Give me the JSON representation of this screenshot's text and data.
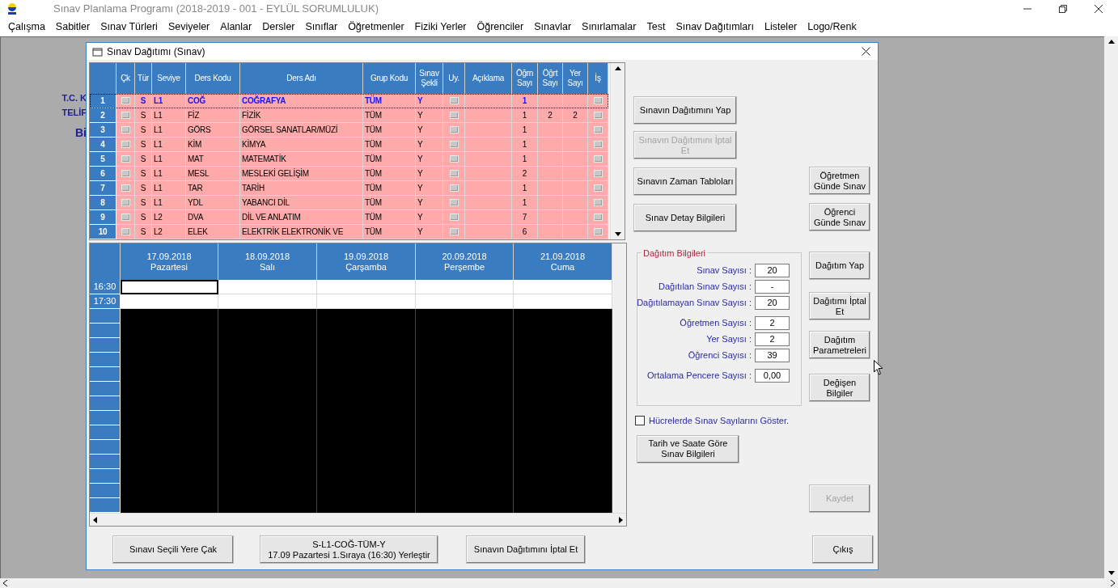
{
  "app": {
    "title": "Sınav Planlama Programı (2018-2019 - 001 - EYLÜL SORUMLULUK)",
    "menu": [
      "Çalışma",
      "Sabitler",
      "Sınav Türleri",
      "Seviyeler",
      "Alanlar",
      "Dersler",
      "Sınıflar",
      "Öğretmenler",
      "Fiziki Yerler",
      "Öğrenciler",
      "Sınavlar",
      "Sınırlamalar",
      "Test",
      "Sınav Dağıtımları",
      "Listeler",
      "Logo/Renk"
    ]
  },
  "background_texts": [
    "T.C. K",
    "TELİF",
    "Bi"
  ],
  "dialog": {
    "title": "Sınav Dağıtımı (Sınav)",
    "exam_table": {
      "columns": [
        "Çk",
        "Tür",
        "Seviye",
        "Ders Kodu",
        "Ders Adı",
        "Grup Kodu",
        "Sınav\nŞekli",
        "Uy.",
        "Açıklama",
        "Öğrn\nSayı",
        "Öğrt\nSayı",
        "Yer\nSayı",
        "İş"
      ],
      "rows": [
        {
          "no": "1",
          "ck": false,
          "tur": "S",
          "seviye": "L1",
          "ders_kodu": "COĞ",
          "ders_adi": "COĞRAFYA",
          "grup_kodu": "TÜM",
          "sinav_sekli": "Y",
          "uy": false,
          "ogrn": "1",
          "is": false,
          "selected": true
        },
        {
          "no": "2",
          "ck": false,
          "tur": "S",
          "seviye": "L1",
          "ders_kodu": "FİZ",
          "ders_adi": "FİZİK",
          "grup_kodu": "TÜM",
          "sinav_sekli": "Y",
          "uy": false,
          "ogrn": "1",
          "ogrt": "2",
          "yer": "2",
          "is": false,
          "selected": false
        },
        {
          "no": "3",
          "ck": false,
          "tur": "S",
          "seviye": "L1",
          "ders_kodu": "GÖRS",
          "ders_adi": "GÖRSEL SANATLAR/MÜZİ",
          "grup_kodu": "TÜM",
          "sinav_sekli": "Y",
          "uy": false,
          "ogrn": "1",
          "is": false,
          "selected": false
        },
        {
          "no": "4",
          "ck": false,
          "tur": "S",
          "seviye": "L1",
          "ders_kodu": "KİM",
          "ders_adi": "KİMYA",
          "grup_kodu": "TÜM",
          "sinav_sekli": "Y",
          "uy": false,
          "ogrn": "1",
          "is": false,
          "selected": false
        },
        {
          "no": "5",
          "ck": false,
          "tur": "S",
          "seviye": "L1",
          "ders_kodu": "MAT",
          "ders_adi": "MATEMATİK",
          "grup_kodu": "TÜM",
          "sinav_sekli": "Y",
          "uy": false,
          "ogrn": "1",
          "is": false,
          "selected": false
        },
        {
          "no": "6",
          "ck": false,
          "tur": "S",
          "seviye": "L1",
          "ders_kodu": "MESL",
          "ders_adi": "MESLEKİ GELİŞİM",
          "grup_kodu": "TÜM",
          "sinav_sekli": "Y",
          "uy": false,
          "ogrn": "2",
          "is": false,
          "selected": false
        },
        {
          "no": "7",
          "ck": false,
          "tur": "S",
          "seviye": "L1",
          "ders_kodu": "TAR",
          "ders_adi": "TARİH",
          "grup_kodu": "TÜM",
          "sinav_sekli": "Y",
          "uy": false,
          "ogrn": "1",
          "is": false,
          "selected": false
        },
        {
          "no": "8",
          "ck": false,
          "tur": "S",
          "seviye": "L1",
          "ders_kodu": "YDL",
          "ders_adi": "YABANCI DİL",
          "grup_kodu": "TÜM",
          "sinav_sekli": "Y",
          "uy": false,
          "ogrn": "1",
          "is": false,
          "selected": false
        },
        {
          "no": "9",
          "ck": false,
          "tur": "S",
          "seviye": "L2",
          "ders_kodu": "DVA",
          "ders_adi": "DİL VE ANLATIM",
          "grup_kodu": "TÜM",
          "sinav_sekli": "Y",
          "uy": false,
          "ogrn": "7",
          "is": false,
          "selected": false
        },
        {
          "no": "10",
          "ck": false,
          "tur": "S",
          "seviye": "L2",
          "ders_kodu": "ELEK",
          "ders_adi": "ELEKTRİK ELEKTRONİK VE",
          "grup_kodu": "TÜM",
          "sinav_sekli": "Y",
          "uy": false,
          "ogrn": "6",
          "is": false,
          "selected": false
        }
      ]
    },
    "schedule": {
      "days": [
        {
          "date": "17.09.2018",
          "day": "Pazartesi"
        },
        {
          "date": "18.09.2018",
          "day": "Salı"
        },
        {
          "date": "19.09.2018",
          "day": "Çarşamba"
        },
        {
          "date": "20.09.2018",
          "day": "Perşembe"
        },
        {
          "date": "21.09.2018",
          "day": "Cuma"
        }
      ],
      "times": [
        {
          "label": "16:30",
          "cells": [
            {
              "selected": true
            },
            {
              "selected": false
            },
            {
              "selected": false
            },
            {
              "selected": false
            },
            {
              "selected": false
            }
          ]
        },
        {
          "label": "17:30",
          "cells": [
            {
              "selected": false
            },
            {
              "selected": false
            },
            {
              "selected": false
            },
            {
              "selected": false
            },
            {
              "selected": false
            }
          ]
        }
      ]
    },
    "exam_buttons": [
      {
        "label": "Sınavın Dağıtımını Yap",
        "disabled": false
      },
      {
        "label": "Sınavın Dağıtımını İptal Et",
        "disabled": true
      },
      {
        "label": "Sınavın Zaman Tabloları",
        "disabled": false
      },
      {
        "label": "Sınav Detay Bilgileri",
        "disabled": false
      }
    ],
    "info": {
      "title": "Dağıtım Bilgileri",
      "fields": [
        {
          "label": "Sınav Sayısı :",
          "value": "20"
        },
        {
          "label": "Dağıtılan Sınav Sayısı :",
          "value": "-"
        },
        {
          "label": "Dağıtılamayan Sınav Sayısı :",
          "value": "20"
        },
        {
          "label": "Öğretmen Sayısı :",
          "value": "2"
        },
        {
          "label": "Yer Sayısı :",
          "value": "2"
        },
        {
          "label": "Öğrenci Sayısı :",
          "value": "39"
        },
        {
          "label": "Ortalama Pencere Sayısı :",
          "value": "0,00"
        }
      ]
    },
    "show_counts": {
      "label": "Hücrelerde Sınav Sayılarını Göster.",
      "checked": false
    },
    "report_button": "Tarih ve Saate Göre Sınav Bilgileri",
    "side_buttons": [
      {
        "label": "Öğretmen Günde Sınav",
        "disabled": false
      },
      {
        "label": "Öğrenci Günde Sınav",
        "disabled": false
      },
      {
        "label": "Dağıtım Yap",
        "disabled": false
      },
      {
        "label": "Dağıtımı İptal Et",
        "disabled": false
      },
      {
        "label": "Dağıtım Parametreleri",
        "disabled": false
      },
      {
        "label": "Değişen Bilgiler",
        "disabled": false
      },
      {
        "label": "Kaydet",
        "disabled": true
      }
    ],
    "bottom_buttons": [
      {
        "label": "Sınavı Seçili Yere Çak"
      },
      {
        "label": "S-L1-COĞ-TÜM-Y\n17.09 Pazartesi 1.Sıraya (16:30) Yerleştir"
      },
      {
        "label": "Sınavın Dağıtımını İptal Et"
      }
    ],
    "exit_button": "Çıkış"
  }
}
